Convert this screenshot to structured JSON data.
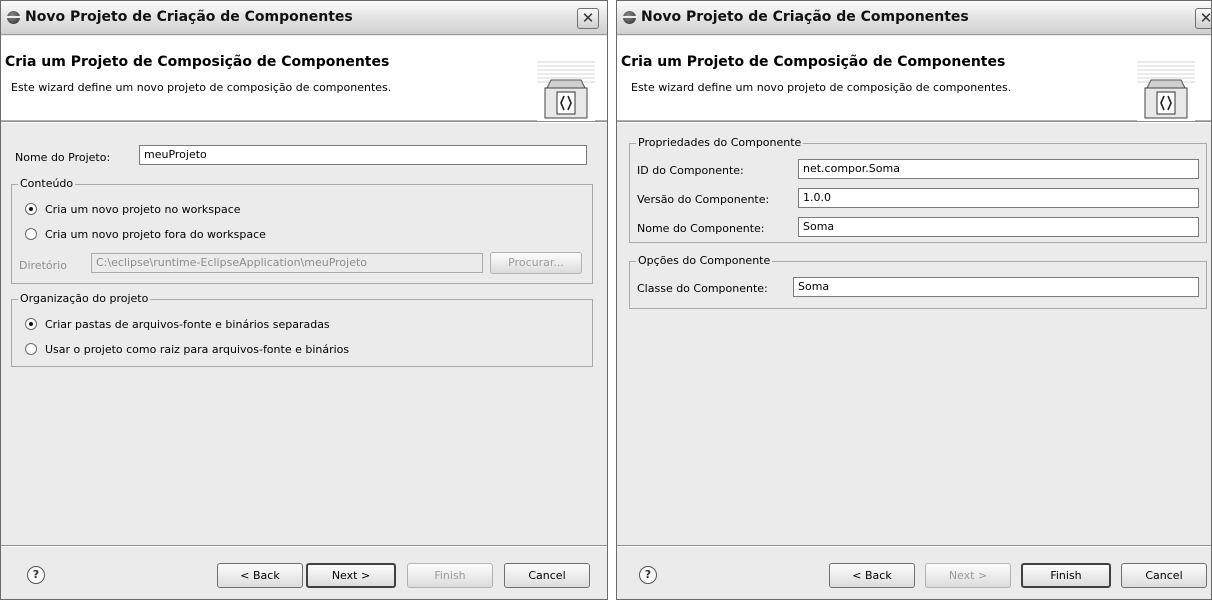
{
  "wizard_a": {
    "title": "Novo Projeto de Criação de Componentes",
    "close_symbol": "✕",
    "banner": {
      "title": "Cria um Projeto de Composição de Componentes",
      "description": "Este wizard define um novo projeto de composição de componentes."
    },
    "project_name": {
      "label": "Nome do Projeto:",
      "value": "meuProjeto"
    },
    "content_group": {
      "legend": "Conteúdo",
      "option_new_in_workspace": "Cria um novo projeto no workspace",
      "option_new_outside_workspace": "Cria um novo projeto fora do workspace",
      "selected": "option_new_in_workspace",
      "directory_label": "Diretório",
      "directory_value": "C:\\eclipse\\runtime-EclipseApplication\\meuProjeto",
      "browse_label": "Procurar..."
    },
    "organization_group": {
      "legend": "Organização do projeto",
      "option_separate_folders": "Criar pastas de arquivos-fonte e binários separadas",
      "option_project_as_root": "Usar o projeto como raiz para arquivos-fonte e binários",
      "selected": "option_separate_folders"
    },
    "footer": {
      "help_symbol": "?",
      "back_label": "< Back",
      "next_label": "Next >",
      "finish_label": "Finish",
      "cancel_label": "Cancel"
    }
  },
  "wizard_b": {
    "title": "Novo Projeto de Criação de Componentes",
    "close_symbol": "✕",
    "banner": {
      "title": "Cria um Projeto de Composição de Componentes",
      "description": "Este wizard define um novo projeto de composição de componentes."
    },
    "properties_group": {
      "legend": "Propriedades do Componente",
      "id_label": "ID do Componente:",
      "id_value": "net.compor.Soma",
      "version_label": "Versão do Componente:",
      "version_value": "1.0.0",
      "name_label": "Nome do Componente:",
      "name_value": "Soma"
    },
    "options_group": {
      "legend": "Opções do Componente",
      "class_label": "Classe do Componente:",
      "class_value": "Soma"
    },
    "footer": {
      "help_symbol": "?",
      "back_label": "< Back",
      "next_label": "Next >",
      "finish_label": "Finish",
      "cancel_label": "Cancel"
    }
  },
  "icons": [
    "wizard-banner-icon",
    "app-icon",
    "close-icon",
    "help-icon"
  ],
  "colors": {
    "dialog_bg": "#ebebeb",
    "banner_bg": "#ffffff",
    "border": "#707070"
  }
}
